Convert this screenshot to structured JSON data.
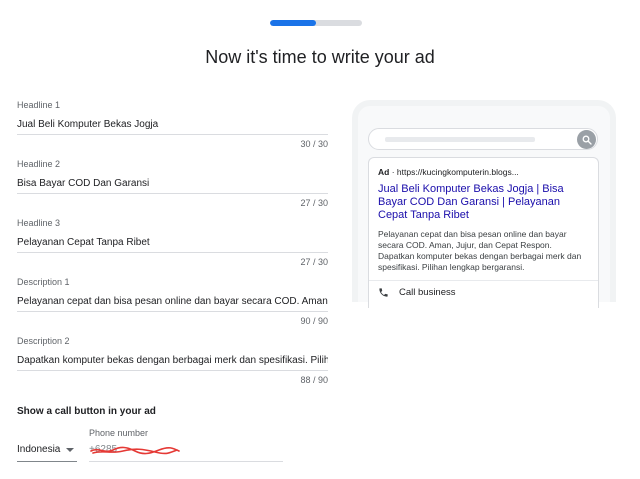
{
  "progress": {
    "fraction": 0.5,
    "fill_color": "#1a73e8",
    "track_color": "#dadce0"
  },
  "page_title": "Now it's time to write your ad",
  "fields": [
    {
      "label": "Headline 1",
      "value": "Jual Beli Komputer Bekas Jogja",
      "count": "30 / 30"
    },
    {
      "label": "Headline 2",
      "value": "Bisa Bayar  COD Dan Garansi",
      "count": "27 / 30"
    },
    {
      "label": "Headline 3",
      "value": "Pelayanan Cepat Tanpa Ribet",
      "count": "27 / 30"
    },
    {
      "label": "Description 1",
      "value": "Pelayanan cepat dan bisa pesan online dan bayar secara COD. Aman, Jujur, dan Cepat Respon.",
      "count": "90 / 90"
    },
    {
      "label": "Description 2",
      "value": "Dapatkan komputer bekas dengan berbagai merk dan spesifikasi. Pilihan lengkap bergaransi.",
      "count": "88 / 90"
    }
  ],
  "call": {
    "title": "Show a call button in your ad",
    "country": "Indonesia",
    "phone_label": "Phone number",
    "phone_value": "+6285",
    "redaction_color": "#e53935"
  },
  "preview": {
    "ad_badge": "Ad",
    "url": " · https://kucingkomputerin.blogs...",
    "headline": "Jual Beli Komputer Bekas Jogja | Bisa Bayar COD Dan Garansi | Pelayanan Cepat Tanpa Ribet",
    "description": "Pelayanan cepat dan bisa pesan online dan bayar secara COD. Aman, Jujur, dan Cepat Respon. Dapatkan komputer bekas dengan berbagai merk dan spesifikasi. Pilihan lengkap bergaransi.",
    "call_label": "Call business",
    "headline_color": "#1a0dab"
  },
  "icons": {
    "search": "search-icon",
    "phone": "phone-icon",
    "dropdown": "chevron-down-icon"
  }
}
